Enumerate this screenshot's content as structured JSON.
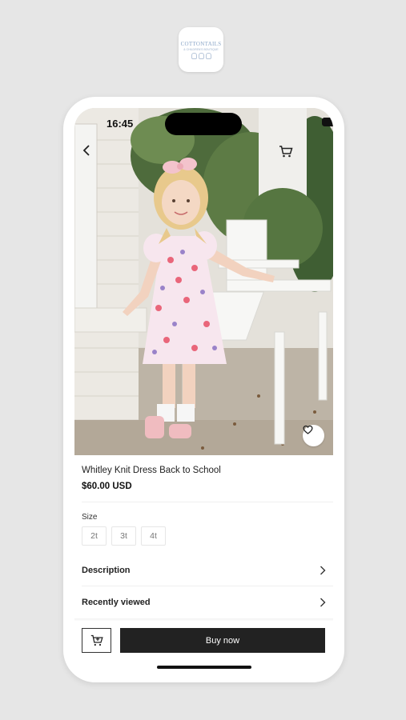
{
  "app": {
    "logo_text": "COTTONTAILS",
    "logo_tagline": "& CHILDREN'S BOUTIQUE"
  },
  "status_bar": {
    "time": "16:45"
  },
  "icons": {
    "back": "chevron-left-icon",
    "cart": "cart-icon",
    "favorite": "heart-icon",
    "wifi": "wifi-icon",
    "battery": "battery-icon",
    "row_chevron": "chevron-right-icon"
  },
  "product": {
    "title": "Whitley Knit Dress Back to School",
    "price": "$60.00 USD"
  },
  "size": {
    "label": "Size",
    "options": [
      "2t",
      "3t",
      "4t"
    ]
  },
  "sections": {
    "description": "Description",
    "recently_viewed": "Recently viewed"
  },
  "actions": {
    "buy_now": "Buy now"
  },
  "colors": {
    "primary_button": "#222222",
    "background": "#e6e6e6"
  }
}
